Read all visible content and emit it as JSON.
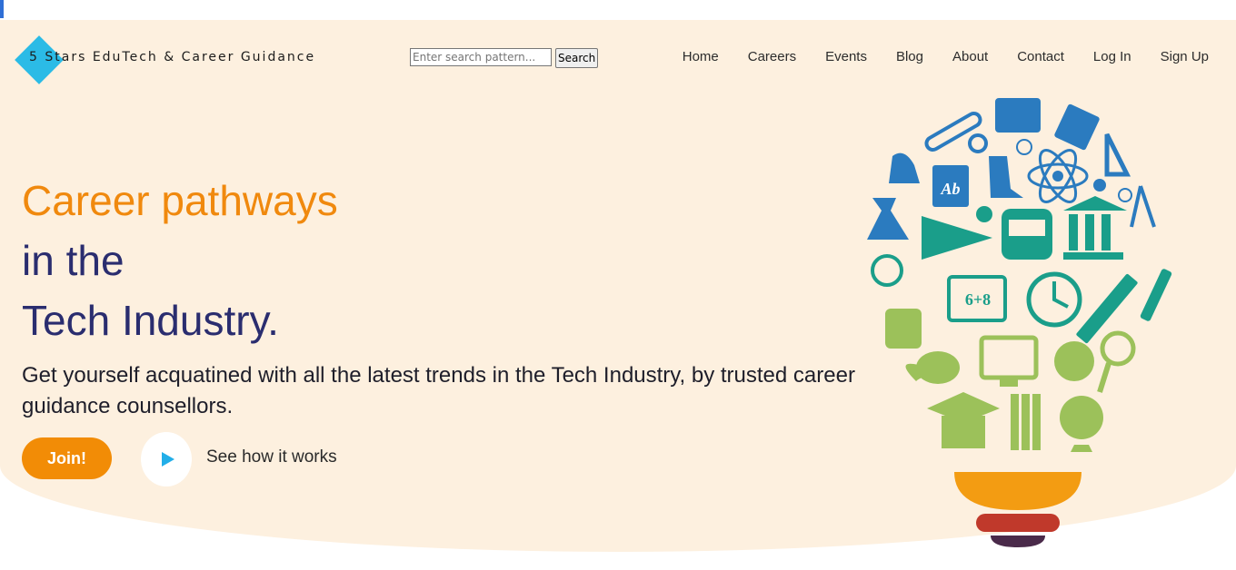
{
  "brand": {
    "name": "5 Stars EduTech & Career Guidance"
  },
  "search": {
    "placeholder": "Enter search pattern...",
    "button_label": "Search"
  },
  "nav": {
    "items": [
      "Home",
      "Careers",
      "Events",
      "Blog",
      "About",
      "Contact",
      "Log In",
      "Sign Up"
    ]
  },
  "hero": {
    "headline_line1": "Career pathways",
    "headline_line2": "in the",
    "headline_line3": "Tech Industry.",
    "subtext": "Get yourself acquatined with all the latest trends in the Tech Industry, by trusted career guidance counsellors.",
    "join_label": "Join!",
    "see_how_label": "See how it works",
    "math_label": "6+8",
    "book_label": "Ab"
  },
  "colors": {
    "accent_orange": "#f28c06",
    "headline_navy": "#2a2d6f",
    "hero_bg": "#fdf0df",
    "brand_cyan": "#2bbbe6",
    "bulb_blue": "#2b7bbf",
    "bulb_teal": "#1a9e8a",
    "bulb_green": "#9cc15a",
    "bulb_base_red": "#c0392b",
    "bulb_base_purple": "#4a2a4a"
  },
  "icons": [
    "logo-diamond-icon",
    "play-icon",
    "lightbulb-illustration"
  ]
}
